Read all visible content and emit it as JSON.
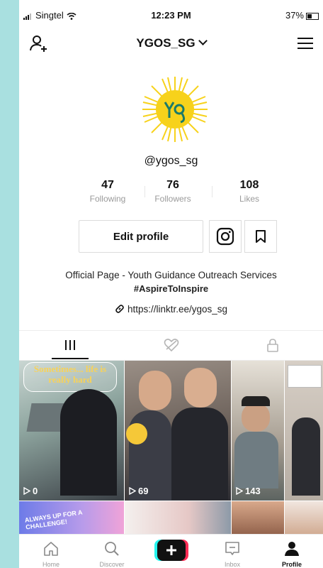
{
  "status": {
    "carrier": "Singtel",
    "time": "12:23 PM",
    "battery": "37%"
  },
  "header": {
    "username": "YGOS_SG"
  },
  "profile": {
    "handle": "@ygos_sg",
    "stats": [
      {
        "value": "47",
        "label": "Following"
      },
      {
        "value": "76",
        "label": "Followers"
      },
      {
        "value": "108",
        "label": "Likes"
      }
    ],
    "edit_label": "Edit profile",
    "bio_line1": "Official Page - Youth Guidance Outreach Services",
    "bio_line2": "#AspireToInspire",
    "link": "https://linktr.ee/ygos_sg"
  },
  "videos": [
    {
      "views": "0",
      "overlay": "Sometimes... life is really hard"
    },
    {
      "views": "69"
    },
    {
      "views": "143"
    },
    {
      "views": ""
    },
    {
      "overlay": "ALWAYS UP FOR A CHALLENGE!"
    }
  ],
  "nav": [
    {
      "label": "Home",
      "icon": "home-icon"
    },
    {
      "label": "Discover",
      "icon": "search-icon"
    },
    {
      "label": "",
      "icon": "plus-icon"
    },
    {
      "label": "Inbox",
      "icon": "inbox-icon"
    },
    {
      "label": "Profile",
      "icon": "profile-icon"
    }
  ],
  "colors": {
    "accent_red": "#fe2c55",
    "accent_cyan": "#25f4ee",
    "logo_yellow": "#f7d21b"
  }
}
